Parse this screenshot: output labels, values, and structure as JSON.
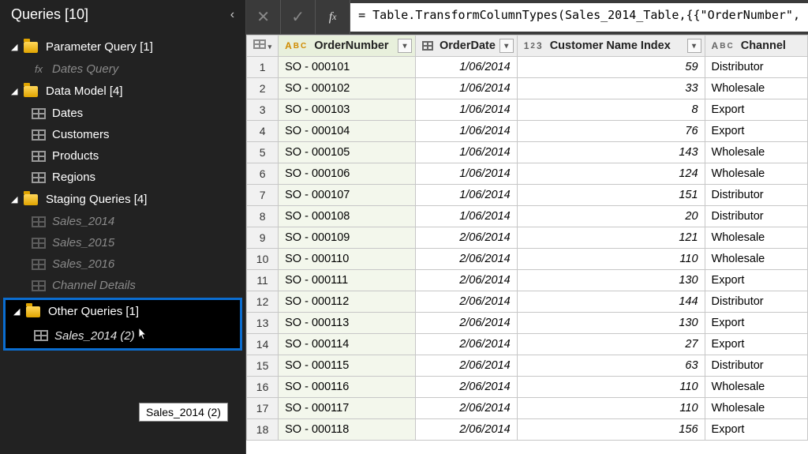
{
  "sidebar": {
    "title": "Queries [10]",
    "groups": [
      {
        "label": "Parameter Query [1]",
        "items": [
          {
            "label": "Dates Query",
            "icon": "fx",
            "muted": true
          }
        ]
      },
      {
        "label": "Data Model [4]",
        "items": [
          {
            "label": "Dates",
            "icon": "table"
          },
          {
            "label": "Customers",
            "icon": "table"
          },
          {
            "label": "Products",
            "icon": "table"
          },
          {
            "label": "Regions",
            "icon": "table"
          }
        ]
      },
      {
        "label": "Staging Queries [4]",
        "items": [
          {
            "label": "Sales_2014",
            "icon": "table",
            "muted": true
          },
          {
            "label": "Sales_2015",
            "icon": "table",
            "muted": true
          },
          {
            "label": "Sales_2016",
            "icon": "table",
            "muted": true
          },
          {
            "label": "Channel Details",
            "icon": "table",
            "muted": true
          }
        ]
      }
    ],
    "selected_group": {
      "label": "Other Queries [1]",
      "items": [
        {
          "label": "Sales_2014 (2)",
          "icon": "table"
        }
      ]
    },
    "tooltip": "Sales_2014 (2)"
  },
  "formula_bar": {
    "text": "= Table.TransformColumnTypes(Sales_2014_Table,{{\"OrderNumber\","
  },
  "table": {
    "columns": [
      {
        "name": "OrderNumber",
        "type": "ABC",
        "selected": true
      },
      {
        "name": "OrderDate",
        "type": "date"
      },
      {
        "name": "Customer Name Index",
        "type": "123"
      },
      {
        "name": "Channel",
        "type": "ABC"
      }
    ],
    "rows": [
      {
        "n": 1,
        "OrderNumber": "SO - 000101",
        "OrderDate": "1/06/2014",
        "CustomerNameIndex": 59,
        "Channel": "Distributor"
      },
      {
        "n": 2,
        "OrderNumber": "SO - 000102",
        "OrderDate": "1/06/2014",
        "CustomerNameIndex": 33,
        "Channel": "Wholesale"
      },
      {
        "n": 3,
        "OrderNumber": "SO - 000103",
        "OrderDate": "1/06/2014",
        "CustomerNameIndex": 8,
        "Channel": "Export"
      },
      {
        "n": 4,
        "OrderNumber": "SO - 000104",
        "OrderDate": "1/06/2014",
        "CustomerNameIndex": 76,
        "Channel": "Export"
      },
      {
        "n": 5,
        "OrderNumber": "SO - 000105",
        "OrderDate": "1/06/2014",
        "CustomerNameIndex": 143,
        "Channel": "Wholesale"
      },
      {
        "n": 6,
        "OrderNumber": "SO - 000106",
        "OrderDate": "1/06/2014",
        "CustomerNameIndex": 124,
        "Channel": "Wholesale"
      },
      {
        "n": 7,
        "OrderNumber": "SO - 000107",
        "OrderDate": "1/06/2014",
        "CustomerNameIndex": 151,
        "Channel": "Distributor"
      },
      {
        "n": 8,
        "OrderNumber": "SO - 000108",
        "OrderDate": "1/06/2014",
        "CustomerNameIndex": 20,
        "Channel": "Distributor"
      },
      {
        "n": 9,
        "OrderNumber": "SO - 000109",
        "OrderDate": "2/06/2014",
        "CustomerNameIndex": 121,
        "Channel": "Wholesale"
      },
      {
        "n": 10,
        "OrderNumber": "SO - 000110",
        "OrderDate": "2/06/2014",
        "CustomerNameIndex": 110,
        "Channel": "Wholesale"
      },
      {
        "n": 11,
        "OrderNumber": "SO - 000111",
        "OrderDate": "2/06/2014",
        "CustomerNameIndex": 130,
        "Channel": "Export"
      },
      {
        "n": 12,
        "OrderNumber": "SO - 000112",
        "OrderDate": "2/06/2014",
        "CustomerNameIndex": 144,
        "Channel": "Distributor"
      },
      {
        "n": 13,
        "OrderNumber": "SO - 000113",
        "OrderDate": "2/06/2014",
        "CustomerNameIndex": 130,
        "Channel": "Export"
      },
      {
        "n": 14,
        "OrderNumber": "SO - 000114",
        "OrderDate": "2/06/2014",
        "CustomerNameIndex": 27,
        "Channel": "Export"
      },
      {
        "n": 15,
        "OrderNumber": "SO - 000115",
        "OrderDate": "2/06/2014",
        "CustomerNameIndex": 63,
        "Channel": "Distributor"
      },
      {
        "n": 16,
        "OrderNumber": "SO - 000116",
        "OrderDate": "2/06/2014",
        "CustomerNameIndex": 110,
        "Channel": "Wholesale"
      },
      {
        "n": 17,
        "OrderNumber": "SO - 000117",
        "OrderDate": "2/06/2014",
        "CustomerNameIndex": 110,
        "Channel": "Wholesale"
      },
      {
        "n": 18,
        "OrderNumber": "SO - 000118",
        "OrderDate": "2/06/2014",
        "CustomerNameIndex": 156,
        "Channel": "Export"
      }
    ]
  }
}
